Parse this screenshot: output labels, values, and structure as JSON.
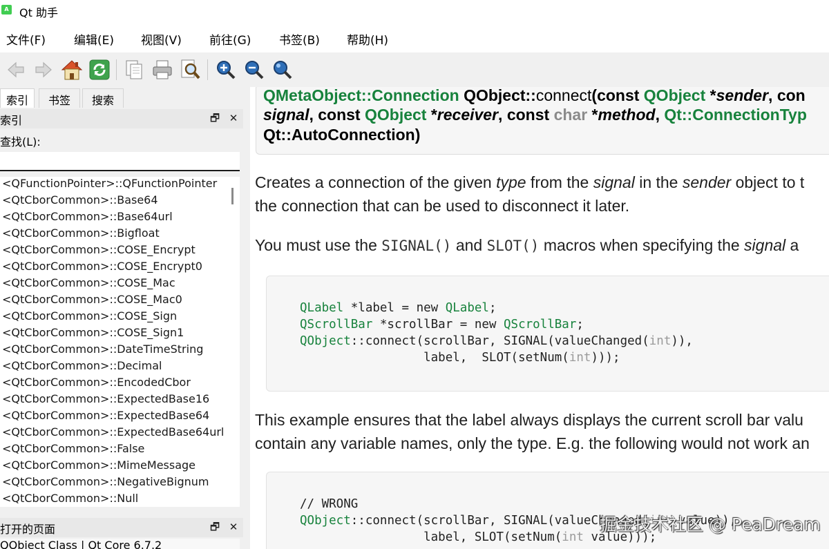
{
  "window": {
    "title": "Qt 助手",
    "app_icon_text": "A"
  },
  "menu": [
    {
      "label": "文件(F)"
    },
    {
      "label": "编辑(E)"
    },
    {
      "label": "视图(V)"
    },
    {
      "label": "前往(G)"
    },
    {
      "label": "书签(B)"
    },
    {
      "label": "帮助(H)"
    }
  ],
  "toolbar": {
    "icons": [
      "back-icon",
      "forward-icon",
      "home-icon",
      "sync-icon",
      "copy-icon",
      "print-icon",
      "find-icon",
      "zoom-in-icon",
      "zoom-out-icon",
      "reset-zoom-icon"
    ]
  },
  "left": {
    "tabs": [
      "索引",
      "书签",
      "搜索"
    ],
    "index_dock_title": "索引",
    "find_label": "查找(L):",
    "find_value": "",
    "index_items": [
      "<QFunctionPointer>::QFunctionPointer",
      "<QtCborCommon>::Base64",
      "<QtCborCommon>::Base64url",
      "<QtCborCommon>::Bigfloat",
      "<QtCborCommon>::COSE_Encrypt",
      "<QtCborCommon>::COSE_Encrypt0",
      "<QtCborCommon>::COSE_Mac",
      "<QtCborCommon>::COSE_Mac0",
      "<QtCborCommon>::COSE_Sign",
      "<QtCborCommon>::COSE_Sign1",
      "<QtCborCommon>::DateTimeString",
      "<QtCborCommon>::Decimal",
      "<QtCborCommon>::EncodedCbor",
      "<QtCborCommon>::ExpectedBase16",
      "<QtCborCommon>::ExpectedBase64",
      "<QtCborCommon>::ExpectedBase64url",
      "<QtCborCommon>::False",
      "<QtCborCommon>::MimeMessage",
      "<QtCborCommon>::NegativeBignum",
      "<QtCborCommon>::Null"
    ],
    "open_pages_title": "打开的页面",
    "open_page": "QObject Class | Qt Core 6.7.2"
  },
  "content": {
    "sig": {
      "l1_a": "QMetaObject::Connection",
      "l1_b": "QObject::",
      "l1_c": "connect",
      "l1_d": "(const ",
      "l1_e": "QObject",
      "l1_f": " *",
      "l1_g": "sender",
      "l1_h": ", con",
      "l2_a": "signal",
      "l2_b": ", const ",
      "l2_c": "QObject",
      "l2_d": " *",
      "l2_e": "receiver",
      "l2_f": ", const ",
      "l2_g": "char",
      "l2_h": " *",
      "l2_i": "method",
      "l2_j": ", ",
      "l2_k": "Qt::ConnectionTyp",
      "l3": "Qt::AutoConnection)"
    },
    "p1": {
      "a": "Creates a connection of the given ",
      "b": "type",
      "c": " from the ",
      "d": "signal",
      "e": " in the ",
      "f": "sender",
      "g": " object to t",
      "line2": "the connection that can be used to disconnect it later."
    },
    "p2": {
      "a": "You must use the ",
      "b": "SIGNAL()",
      "c": " and ",
      "d": "SLOT()",
      "e": " macros when specifying the ",
      "f": "signal",
      "g": " a"
    },
    "code1": {
      "l1_a": "QLabel",
      "l1_b": " *label = new ",
      "l1_c": "QLabel",
      "l1_d": ";",
      "l2_a": "QScrollBar",
      "l2_b": " *scrollBar = new ",
      "l2_c": "QScrollBar",
      "l2_d": ";",
      "l3_a": "QObject",
      "l3_b": "::connect(scrollBar, SIGNAL(valueChanged(",
      "l3_c": "int",
      "l3_d": ")),",
      "l4_a": "                 label,  SLOT(setNum(",
      "l4_b": "int",
      "l4_c": ")));"
    },
    "p3": {
      "line1": "This example ensures that the label always displays the current scroll bar valu",
      "line2": "contain any variable names, only the type. E.g. the following would not work an"
    },
    "code2": {
      "l1": "// WRONG",
      "l2_a": "QObject",
      "l2_b": "::connect(scrollBar, SIGNAL(valueChanged(",
      "l2_c": "int",
      "l2_d": " value)),",
      "l3_a": "                 label, SLOT(setNum(",
      "l3_b": "int",
      "l3_c": " value)));"
    }
  },
  "watermark": "掘金技术社区 @ PeaDream",
  "colors": {
    "qt_green": "#17823c",
    "type_gray": "#8b8b8b",
    "code_bg": "#f6f6f6"
  }
}
